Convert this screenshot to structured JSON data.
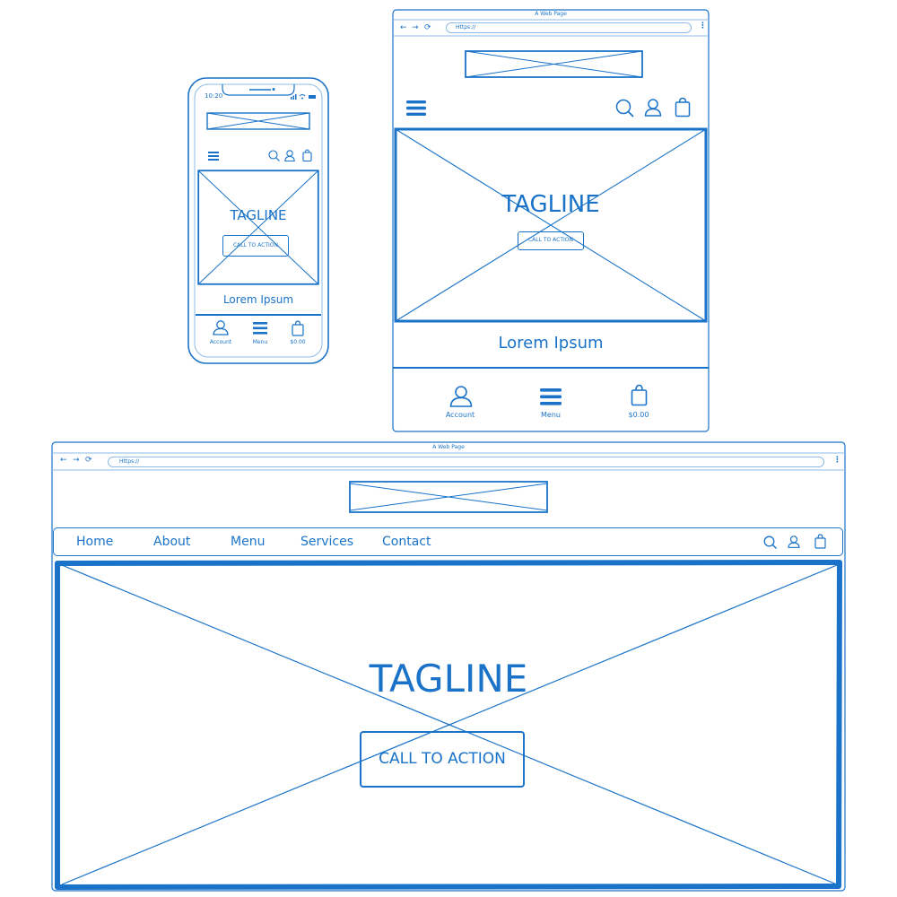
{
  "theme": {
    "stroke": "#1a73c8",
    "light_stroke": "#8cbbe8",
    "background": "#ffffff"
  },
  "mobile": {
    "status_time": "10:20",
    "tagline": "TAGLINE",
    "cta_label": "CALL TO ACTION",
    "content_title": "Lorem Ipsum",
    "bottom_nav": [
      {
        "icon": "user-icon",
        "label": "Account"
      },
      {
        "icon": "hamburger-menu-icon",
        "label": "Menu"
      },
      {
        "icon": "shopping-bag-icon",
        "label": "$0.00"
      }
    ]
  },
  "tablet": {
    "window_title": "A Web Page",
    "url": "Https://",
    "tagline": "TAGLINE",
    "cta_label": "CALL TO ACTION",
    "content_title": "Lorem Ipsum",
    "bottom_nav": [
      {
        "icon": "user-icon",
        "label": "Account"
      },
      {
        "icon": "hamburger-menu-icon",
        "label": "Menu"
      },
      {
        "icon": "shopping-bag-icon",
        "label": "$0.00"
      }
    ]
  },
  "desktop": {
    "window_title": "A Web Page",
    "url": "Https://",
    "nav_items": [
      "Home",
      "About",
      "Menu",
      "Services",
      "Contact"
    ],
    "tagline": "TAGLINE",
    "cta_label": "CALL TO ACTION"
  }
}
